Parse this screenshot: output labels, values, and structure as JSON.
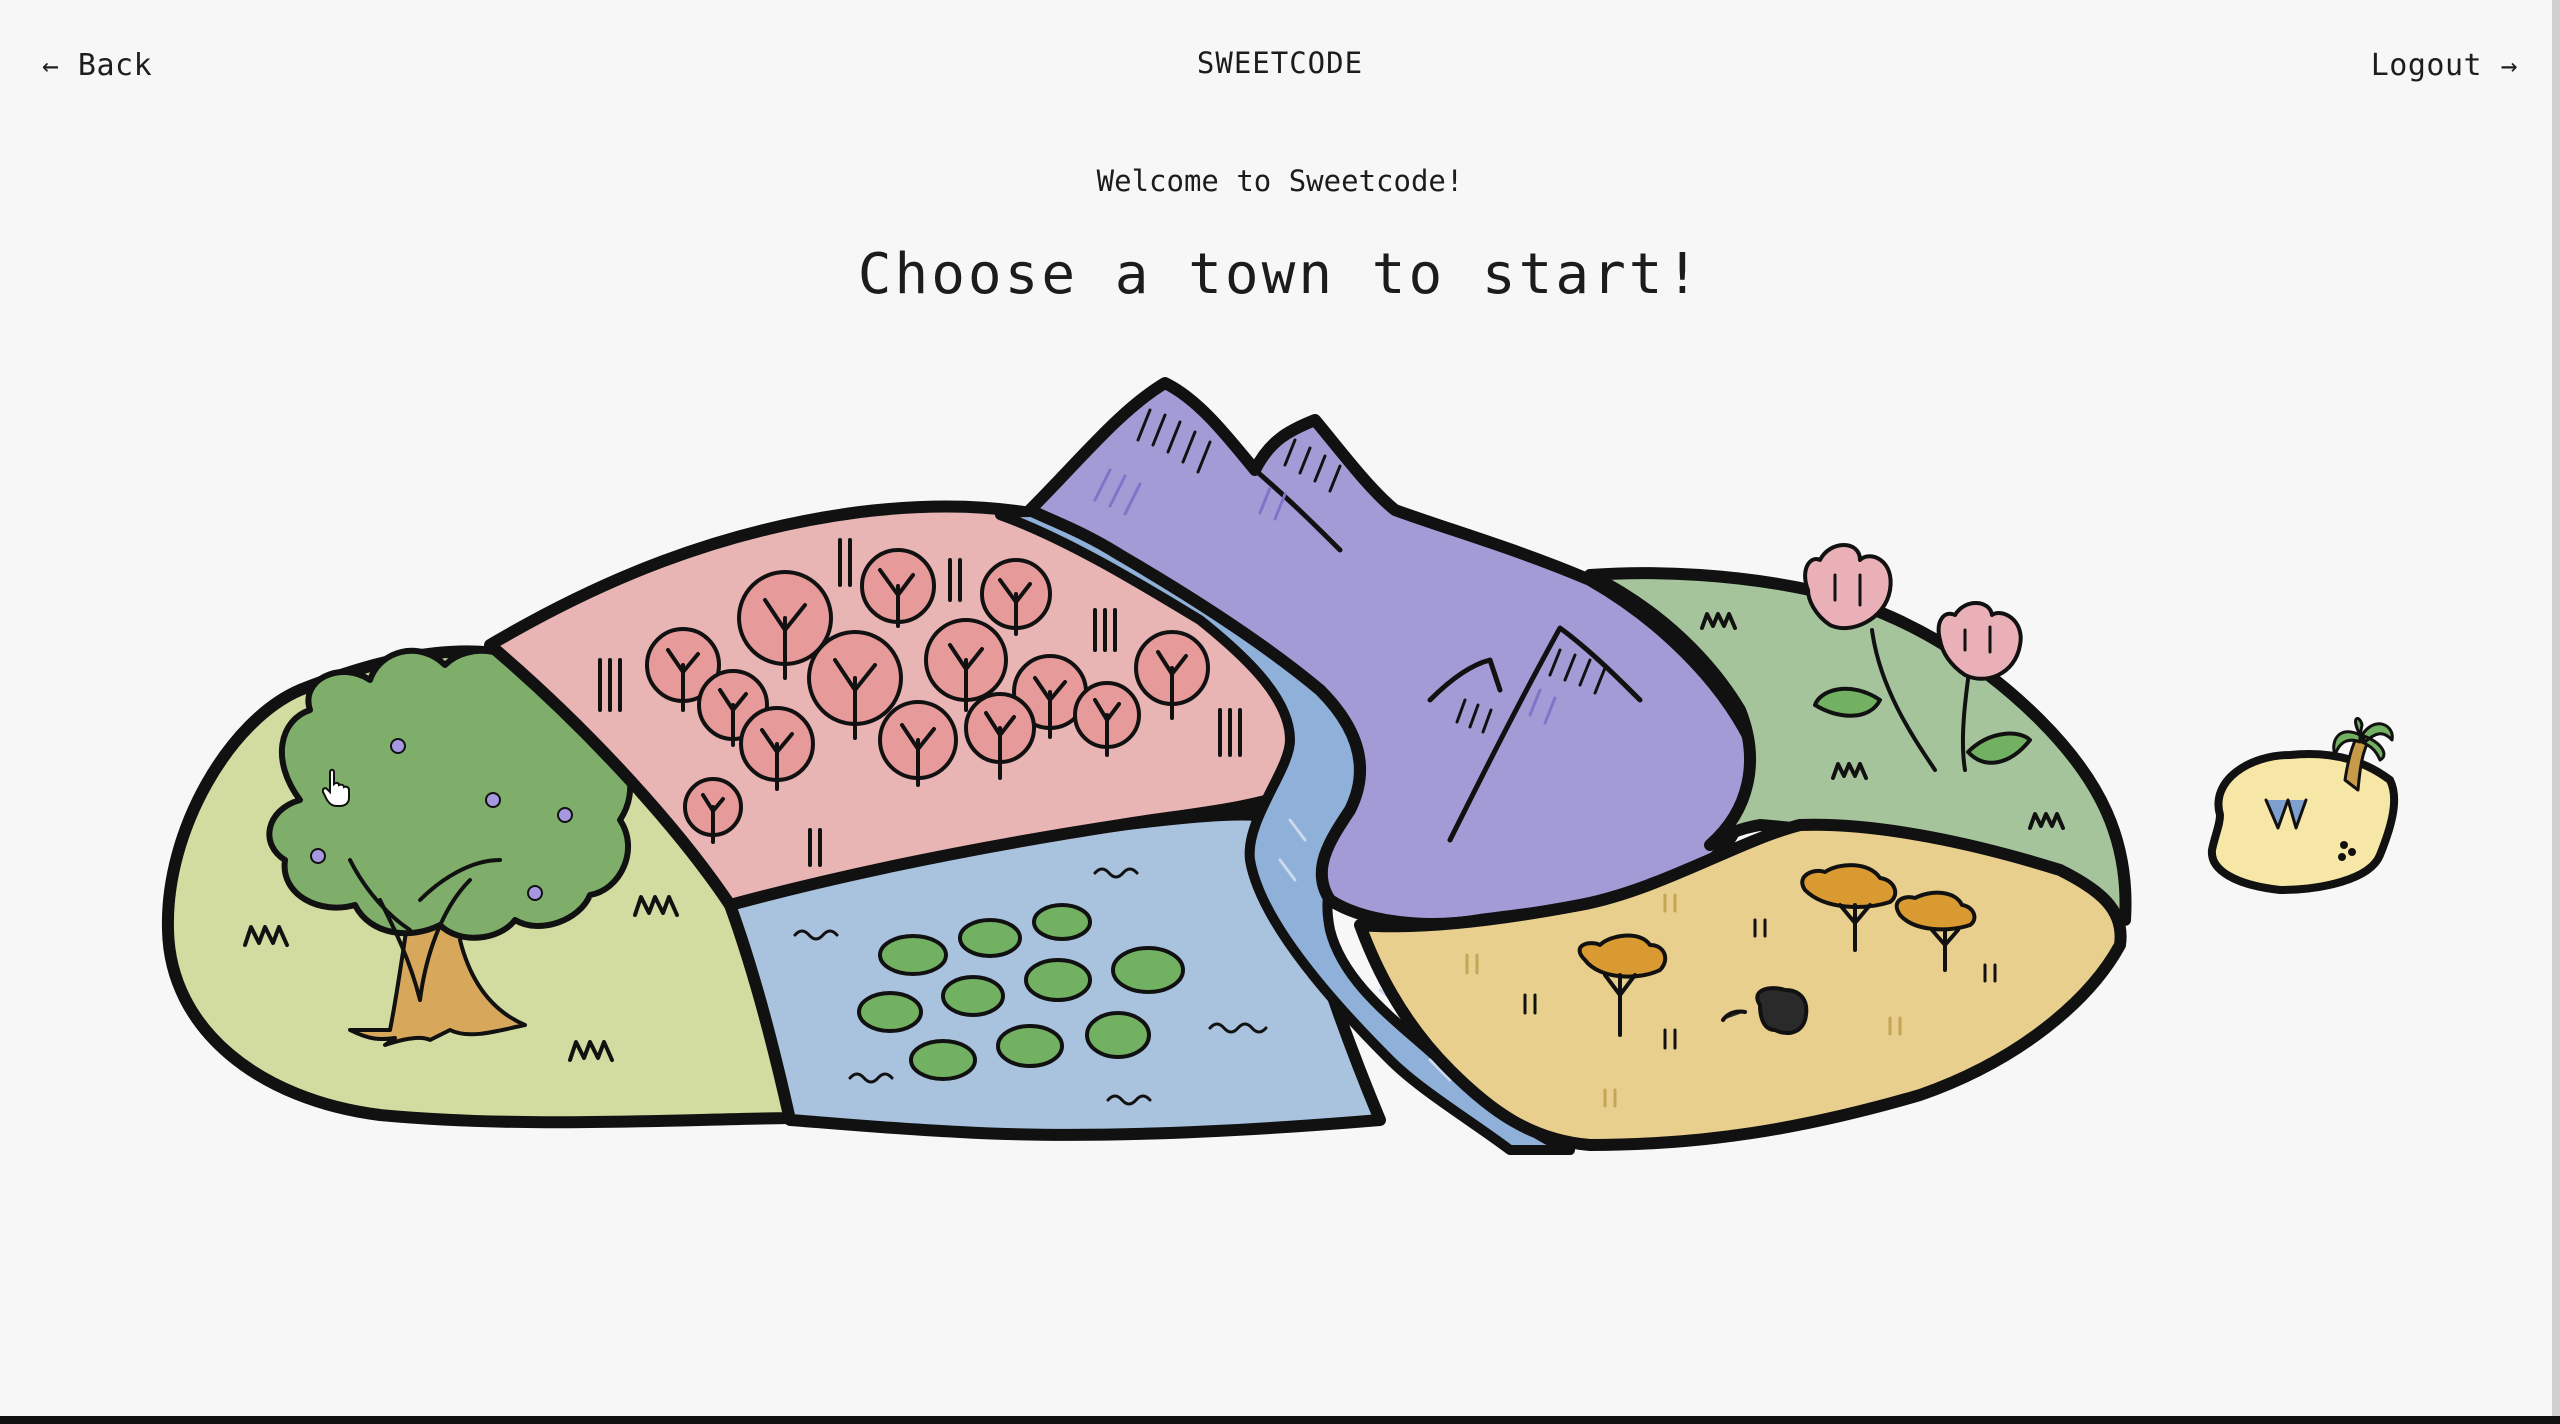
{
  "header": {
    "back_label": "Back",
    "back_arrow": "←",
    "brand": "SWEETCODE",
    "logout_label": "Logout",
    "logout_arrow": "→"
  },
  "main": {
    "welcome": "Welcome to Sweetcode!",
    "heading": "Choose a town to start!"
  },
  "map": {
    "regions": [
      {
        "id": "meadow",
        "icon": "tree-icon",
        "color": "#d3dca0"
      },
      {
        "id": "blossom-forest",
        "icon": "pink-trees-icon",
        "color": "#e8b4b4"
      },
      {
        "id": "mountains",
        "icon": "mountain-icon",
        "color": "#a39bd6"
      },
      {
        "id": "lake",
        "icon": "lily-pads-icon",
        "color": "#a9c3df"
      },
      {
        "id": "river",
        "icon": "river-icon",
        "color": "#8fb0d8"
      },
      {
        "id": "tulip-hills",
        "icon": "tulip-icon",
        "color": "#a6c49b"
      },
      {
        "id": "savanna",
        "icon": "acacia-icon",
        "color": "#e8cf8d"
      },
      {
        "id": "island",
        "icon": "palm-tree-icon",
        "color": "#f6e7a6"
      }
    ],
    "outline_color": "#111111"
  }
}
